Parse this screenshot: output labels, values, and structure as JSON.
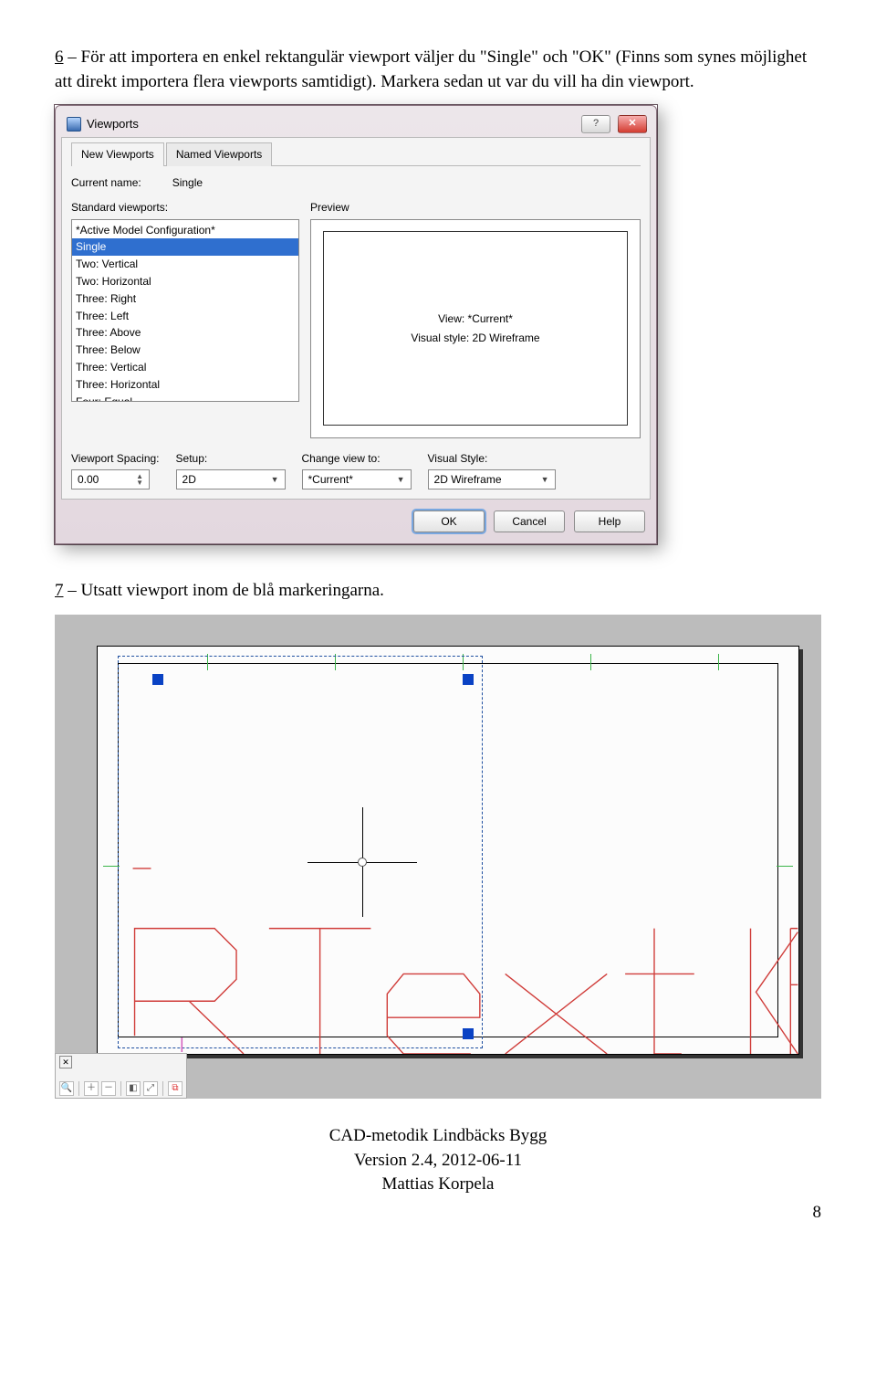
{
  "paragraph_6": {
    "num": "6",
    "text": " – För att importera en enkel rektangulär viewport väljer du \"Single\" och \"OK\" (Finns som synes möjlighet att direkt importera flera viewports samtidigt). Markera sedan ut var du vill ha din viewport."
  },
  "dialog": {
    "title": "Viewports",
    "tabs": {
      "new": "New Viewports",
      "named": "Named Viewports"
    },
    "current_name_label": "Current name:",
    "current_name_value": "Single",
    "standard_label": "Standard viewports:",
    "preview_label": "Preview",
    "list": [
      "*Active Model Configuration*",
      "Single",
      "Two: Vertical",
      "Two: Horizontal",
      "Three: Right",
      "Three: Left",
      "Three: Above",
      "Three: Below",
      "Three: Vertical",
      "Three: Horizontal",
      "Four: Equal"
    ],
    "list_selected_index": 1,
    "preview_view": "View: *Current*",
    "preview_style": "Visual style: 2D Wireframe",
    "spacing_label": "Viewport Spacing:",
    "spacing_value": "0.00",
    "setup_label": "Setup:",
    "setup_value": "2D",
    "changeview_label": "Change view to:",
    "changeview_value": "*Current*",
    "visualstyle_label": "Visual Style:",
    "visualstyle_value": "2D Wireframe",
    "buttons": {
      "ok": "OK",
      "cancel": "Cancel",
      "help": "Help"
    }
  },
  "paragraph_7": {
    "num": "7",
    "text": " – Utsatt viewport inom de blå markeringarna."
  },
  "footer": {
    "line1": "CAD-metodik Lindbäcks Bygg",
    "line2": "Version 2.4, 2012-06-11",
    "line3": "Mattias Korpela",
    "page": "8"
  }
}
